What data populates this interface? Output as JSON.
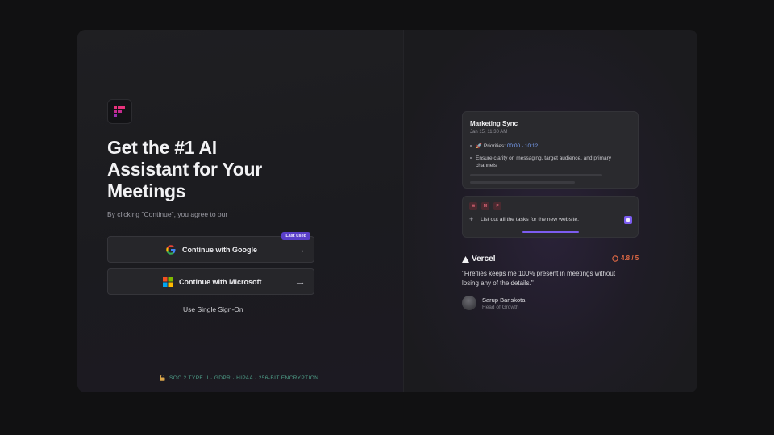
{
  "auth": {
    "headline": "Get the #1 AI\nAssistant for Your\nMeetings",
    "agree_text": "By clicking \"Continue\", you agree to our",
    "google_label": "Continue with Google",
    "google_badge": "Last used",
    "microsoft_label": "Continue with Microsoft",
    "arrow": "→",
    "sso_label": "Use Single Sign-On",
    "compliance": "SOC 2 TYPE II · GDPR · HIPAA · 256-BIT ENCRYPTION"
  },
  "preview": {
    "meeting_title": "Marketing Sync",
    "meeting_date": "Jan 15, 11:30 AM",
    "bullet1_prefix": "🚀 Priorities:",
    "bullet1_time": "00:00 - 10:12",
    "bullet2": "Ensure clarity on messaging, target audience, and primary channels",
    "chips": [
      "✉",
      "M",
      "F"
    ],
    "plus": "+",
    "prompt_text": "List out all the tasks for the new website."
  },
  "testimonial": {
    "company": "Vercel",
    "rating": "4.8 / 5",
    "quote": "\"Fireflies keeps me 100% present in meetings without losing any of the details.\"",
    "author": "Sarup Banskota",
    "role": "Head of Growth"
  },
  "colors": {
    "accent": "#5a3fc9",
    "brand": "#e8327c",
    "compliance": "#4fa08a",
    "rating": "#e36a45",
    "timestamp": "#7ea6ff"
  },
  "icons": {
    "logo": "fireflies-logo-icon",
    "google": "google-icon",
    "microsoft": "microsoft-icon",
    "lock": "lock-icon",
    "vercel": "vercel-triangle-icon",
    "rating": "g2-icon"
  }
}
